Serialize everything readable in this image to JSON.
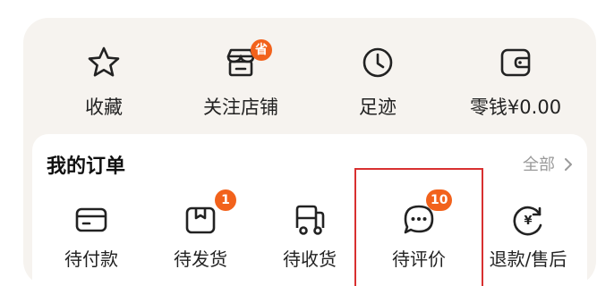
{
  "quick": {
    "favorites": {
      "label": "收藏",
      "icon": "star-icon"
    },
    "followed_stores": {
      "label": "关注店铺",
      "icon": "store-icon",
      "badge": "省"
    },
    "footprints": {
      "label": "足迹",
      "icon": "clock-icon"
    },
    "wallet": {
      "label": "零钱¥0.00",
      "icon": "wallet-icon"
    }
  },
  "orders": {
    "title": "我的订单",
    "all_label": "全部",
    "items": [
      {
        "label": "待付款",
        "icon": "card-icon"
      },
      {
        "label": "待发货",
        "icon": "package-icon",
        "badge": "1"
      },
      {
        "label": "待收货",
        "icon": "truck-icon"
      },
      {
        "label": "待评价",
        "icon": "chat-icon",
        "badge": "10"
      },
      {
        "label": "退款/售后",
        "icon": "refund-icon"
      }
    ]
  },
  "colors": {
    "accent": "#f2621c",
    "highlight_border": "#d83030",
    "card_bg": "#f6f3ef"
  }
}
